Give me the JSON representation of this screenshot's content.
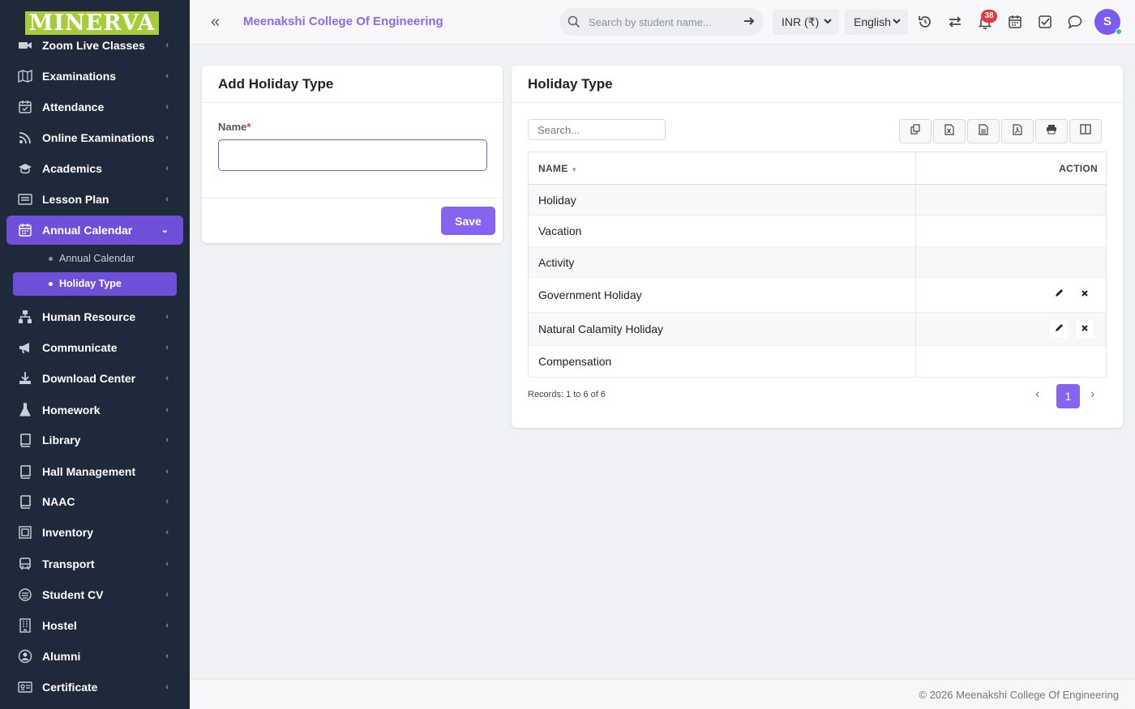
{
  "logo": {
    "text": "MINERVA"
  },
  "sidebar": {
    "items": [
      {
        "label": "Zoom Live Classes",
        "icon": "video-icon"
      },
      {
        "label": "Examinations",
        "icon": "book-open-icon"
      },
      {
        "label": "Attendance",
        "icon": "calendar-check-icon"
      },
      {
        "label": "Online Examinations",
        "icon": "rss-icon"
      },
      {
        "label": "Academics",
        "icon": "graduation-cap-icon"
      },
      {
        "label": "Lesson Plan",
        "icon": "lesson-plan-icon"
      },
      {
        "label": "Annual Calendar",
        "icon": "calendar-icon"
      },
      {
        "label": "Human Resource",
        "icon": "sitemap-icon"
      },
      {
        "label": "Communicate",
        "icon": "megaphone-icon"
      },
      {
        "label": "Download Center",
        "icon": "download-icon"
      },
      {
        "label": "Homework",
        "icon": "flask-icon"
      },
      {
        "label": "Library",
        "icon": "book-icon"
      },
      {
        "label": "Hall Management",
        "icon": "book-icon"
      },
      {
        "label": "NAAC",
        "icon": "book-icon"
      },
      {
        "label": "Inventory",
        "icon": "inventory-icon"
      },
      {
        "label": "Transport",
        "icon": "bus-icon"
      },
      {
        "label": "Student CV",
        "icon": "cv-icon"
      },
      {
        "label": "Hostel",
        "icon": "building-icon"
      },
      {
        "label": "Alumni",
        "icon": "alumni-icon"
      },
      {
        "label": "Certificate",
        "icon": "certificate-icon"
      }
    ],
    "sub_items": [
      {
        "label": "Annual Calendar"
      },
      {
        "label": "Holiday Type"
      }
    ]
  },
  "header": {
    "college_name": "Meenakshi College Of Engineering",
    "search_placeholder": "Search by student name...",
    "currency": "INR (₹)",
    "language": "English",
    "notification_count": "38",
    "avatar_initial": "S"
  },
  "add_form": {
    "title": "Add Holiday Type",
    "name_label": "Name",
    "required_mark": "*",
    "name_value": "",
    "save_label": "Save"
  },
  "list": {
    "title": "Holiday Type",
    "search_placeholder": "Search...",
    "columns": {
      "name": "NAME",
      "action": "ACTION"
    },
    "rows": [
      {
        "name": "Holiday",
        "actions": false
      },
      {
        "name": "Vacation",
        "actions": false
      },
      {
        "name": "Activity",
        "actions": false
      },
      {
        "name": "Government Holiday",
        "actions": true
      },
      {
        "name": "Natural Calamity Holiday",
        "actions": true
      },
      {
        "name": "Compensation",
        "actions": false
      }
    ],
    "records_text": "Records: 1 to 6 of 6",
    "current_page": "1",
    "export_buttons": [
      "copy-icon",
      "excel-icon",
      "csv-icon",
      "pdf-icon",
      "print-icon",
      "columns-icon"
    ]
  },
  "footer": {
    "text": "© 2026 Meenakshi College Of Engineering"
  },
  "colors": {
    "accent": "#8763f2",
    "sidebar_bg": "#1e2a3a",
    "sidebar_active": "#6d4fd8",
    "logo_bg": "#a6cc39",
    "badge": "#e23b3b"
  }
}
